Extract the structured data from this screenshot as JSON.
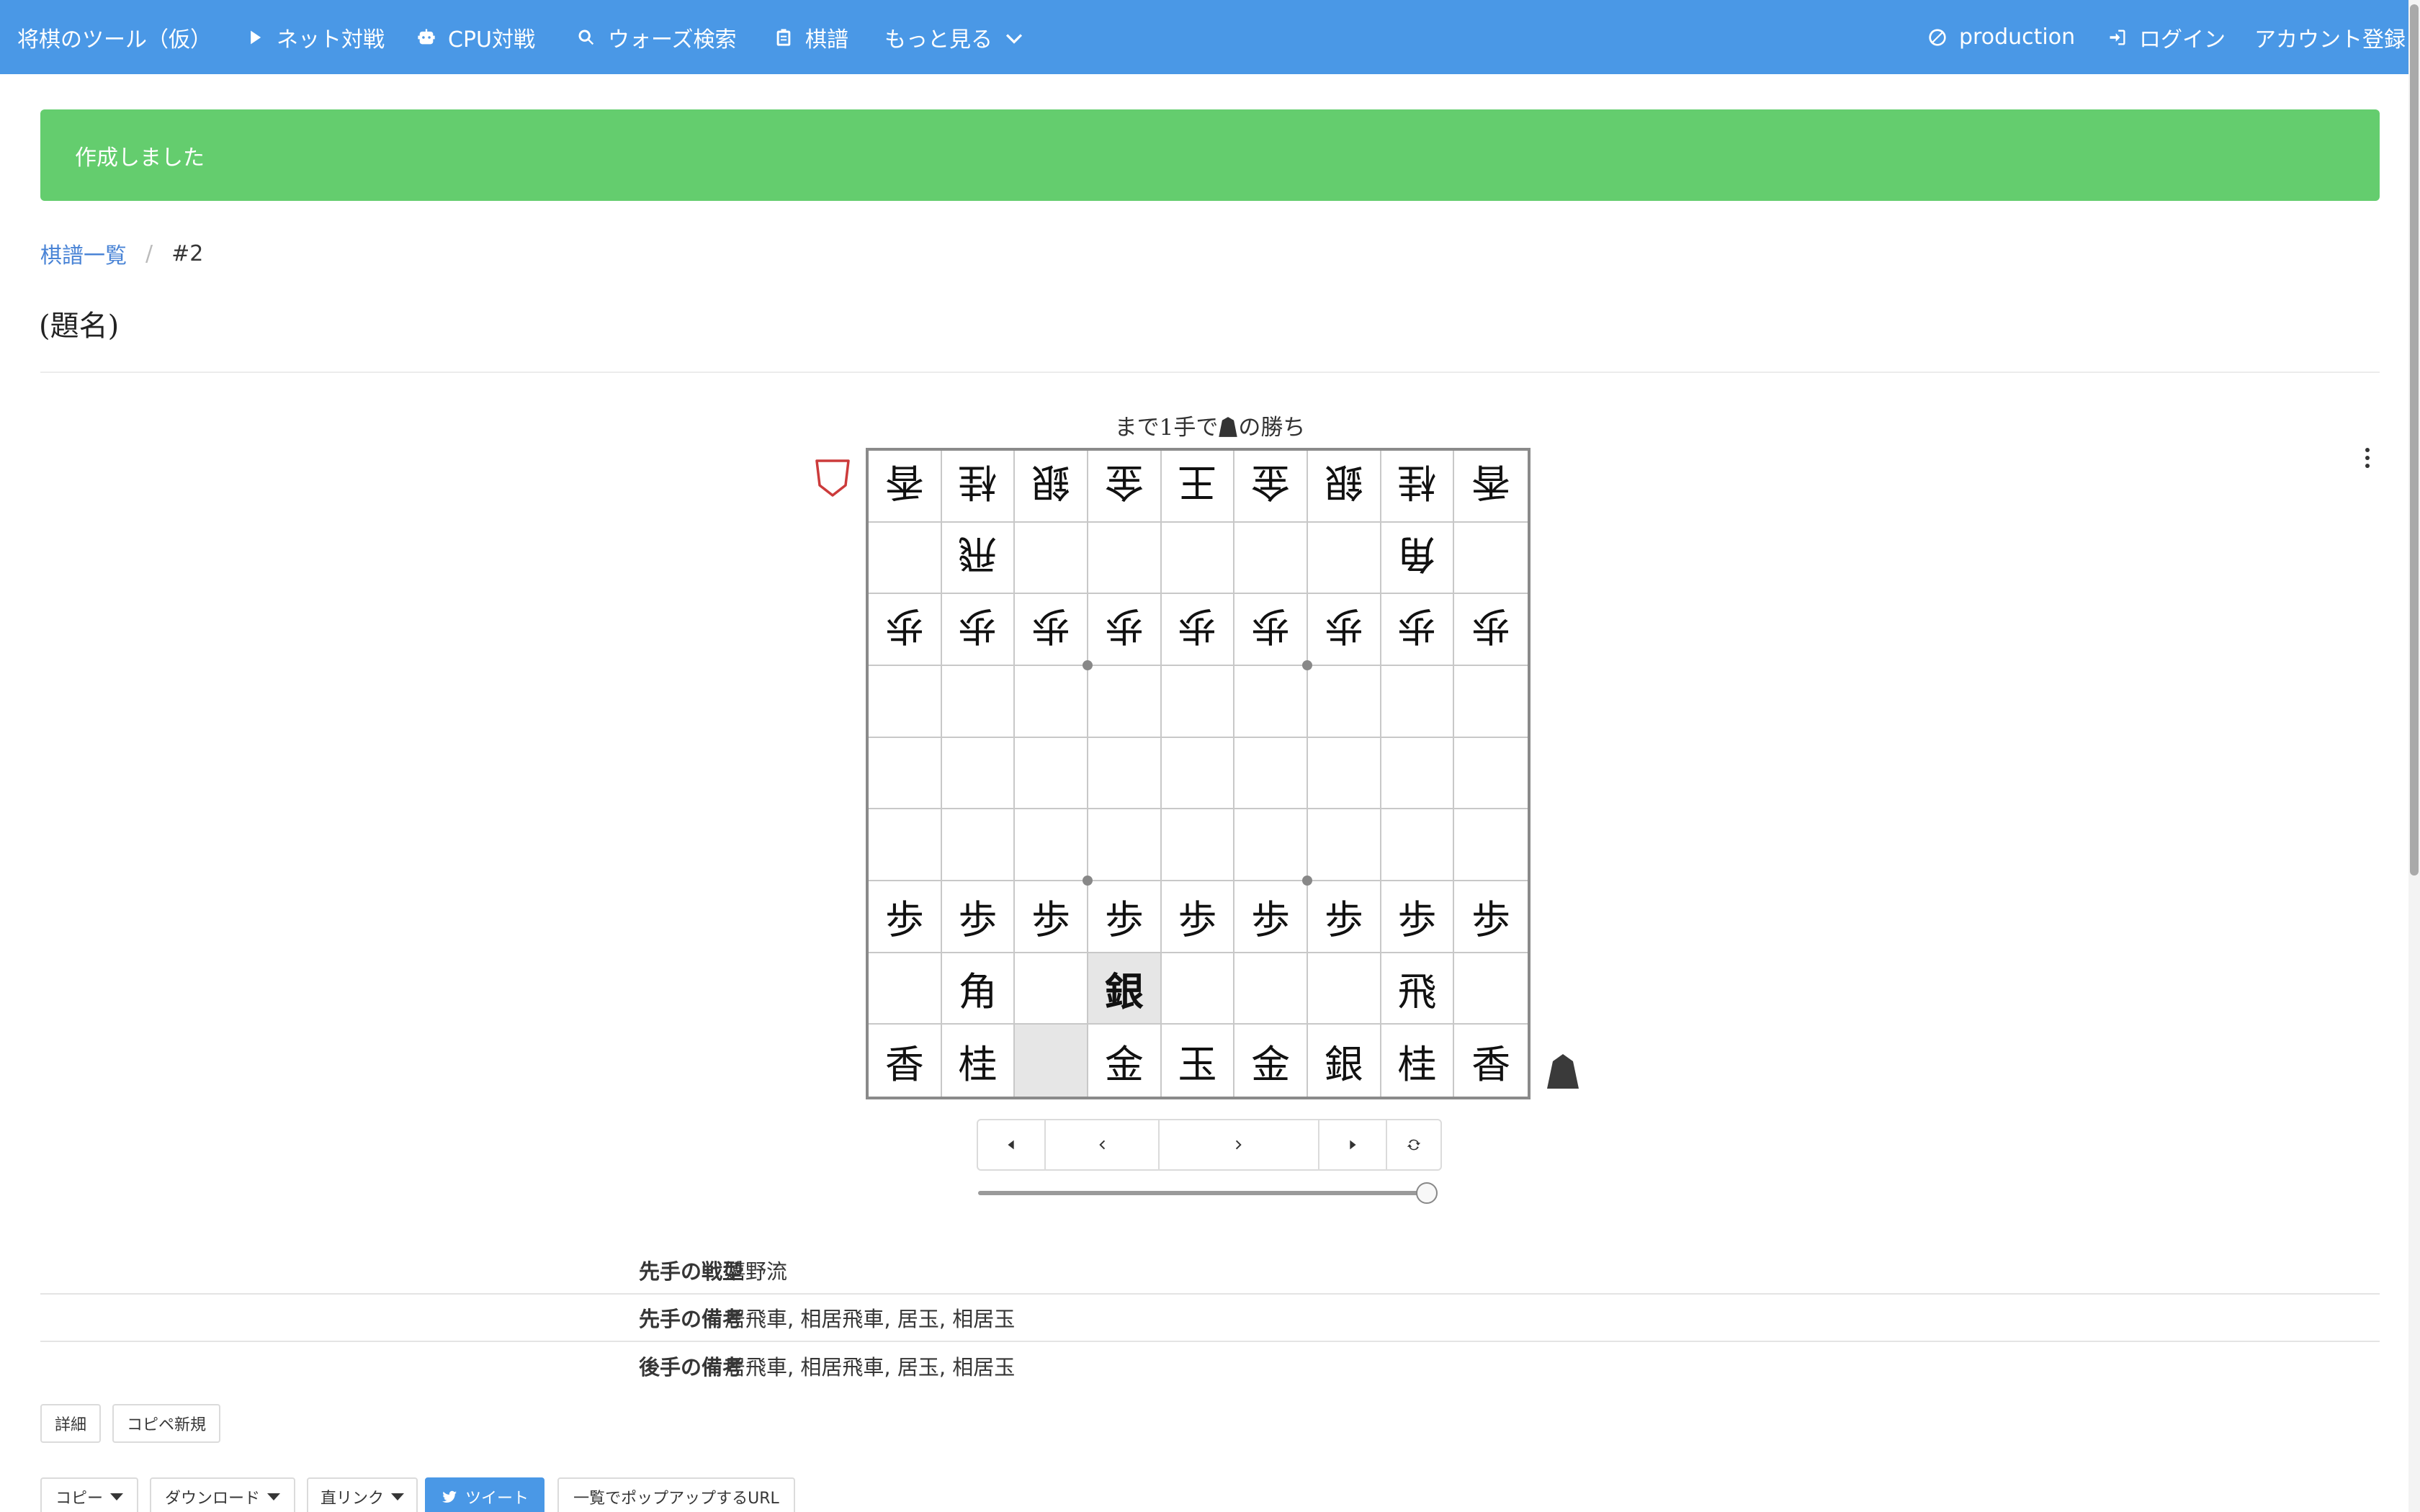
{
  "navbar": {
    "brand": "将棋のツール（仮）",
    "items": [
      {
        "label": "ネット対戦",
        "icon": "play-icon"
      },
      {
        "label": "CPU対戦",
        "icon": "robot-icon"
      },
      {
        "label": "ウォーズ検索",
        "icon": "search-icon"
      },
      {
        "label": "棋譜",
        "icon": "clipboard-icon"
      },
      {
        "label": "もっと見る",
        "icon": "chevron-down-icon"
      }
    ],
    "right": [
      {
        "label": "production",
        "icon": "cancel-circle-icon"
      },
      {
        "label": "ログイン",
        "icon": "login-icon"
      },
      {
        "label": "アカウント登録"
      }
    ]
  },
  "notice": {
    "text": "作成しました",
    "color": "#64cd6e"
  },
  "breadcrumb": {
    "parent": "棋譜一覧",
    "separator": "/",
    "current": "#2"
  },
  "title": "(題名)",
  "board": {
    "result_prefix": "まで1手で",
    "result_suffix": "の勝ち",
    "rows": [
      [
        {
          "p": "香",
          "g": true
        },
        {
          "p": "桂",
          "g": true
        },
        {
          "p": "銀",
          "g": true
        },
        {
          "p": "金",
          "g": true
        },
        {
          "p": "王",
          "g": true
        },
        {
          "p": "金",
          "g": true
        },
        {
          "p": "銀",
          "g": true
        },
        {
          "p": "桂",
          "g": true
        },
        {
          "p": "香",
          "g": true
        }
      ],
      [
        {
          "p": ""
        },
        {
          "p": "飛",
          "g": true
        },
        {
          "p": ""
        },
        {
          "p": ""
        },
        {
          "p": ""
        },
        {
          "p": ""
        },
        {
          "p": ""
        },
        {
          "p": "角",
          "g": true
        },
        {
          "p": ""
        }
      ],
      [
        {
          "p": "歩",
          "g": true
        },
        {
          "p": "歩",
          "g": true
        },
        {
          "p": "歩",
          "g": true
        },
        {
          "p": "歩",
          "g": true
        },
        {
          "p": "歩",
          "g": true
        },
        {
          "p": "歩",
          "g": true
        },
        {
          "p": "歩",
          "g": true
        },
        {
          "p": "歩",
          "g": true
        },
        {
          "p": "歩",
          "g": true
        }
      ],
      [
        {
          "p": ""
        },
        {
          "p": ""
        },
        {
          "p": ""
        },
        {
          "p": ""
        },
        {
          "p": ""
        },
        {
          "p": ""
        },
        {
          "p": ""
        },
        {
          "p": ""
        },
        {
          "p": ""
        }
      ],
      [
        {
          "p": ""
        },
        {
          "p": ""
        },
        {
          "p": ""
        },
        {
          "p": ""
        },
        {
          "p": ""
        },
        {
          "p": ""
        },
        {
          "p": ""
        },
        {
          "p": ""
        },
        {
          "p": ""
        }
      ],
      [
        {
          "p": ""
        },
        {
          "p": ""
        },
        {
          "p": ""
        },
        {
          "p": ""
        },
        {
          "p": ""
        },
        {
          "p": ""
        },
        {
          "p": ""
        },
        {
          "p": ""
        },
        {
          "p": ""
        }
      ],
      [
        {
          "p": "歩"
        },
        {
          "p": "歩"
        },
        {
          "p": "歩"
        },
        {
          "p": "歩"
        },
        {
          "p": "歩"
        },
        {
          "p": "歩"
        },
        {
          "p": "歩"
        },
        {
          "p": "歩"
        },
        {
          "p": "歩"
        }
      ],
      [
        {
          "p": ""
        },
        {
          "p": "角"
        },
        {
          "p": ""
        },
        {
          "p": "銀",
          "last": true,
          "hl": true
        },
        {
          "p": ""
        },
        {
          "p": ""
        },
        {
          "p": ""
        },
        {
          "p": "飛"
        },
        {
          "p": ""
        }
      ],
      [
        {
          "p": "香"
        },
        {
          "p": "桂"
        },
        {
          "p": "",
          "hl": true
        },
        {
          "p": "金"
        },
        {
          "p": "玉"
        },
        {
          "p": "金"
        },
        {
          "p": "銀"
        },
        {
          "p": "桂"
        },
        {
          "p": "香"
        }
      ]
    ],
    "slider_position_fraction": 1.0
  },
  "info": [
    {
      "label": "先手の戦型",
      "value": "嬉野流"
    },
    {
      "label": "先手の備考",
      "value": "居飛車, 相居飛車, 居玉, 相居玉"
    },
    {
      "label": "後手の備考",
      "value": "居飛車, 相居飛車, 居玉, 相居玉"
    }
  ],
  "actions": {
    "detail": "詳細",
    "copy_new": "コピペ新規"
  },
  "share": {
    "copy": "コピー",
    "download": "ダウンロード",
    "direct_link": "直リンク",
    "tweet": "ツイート",
    "popup_url": "一覧でポップアップするURL"
  }
}
